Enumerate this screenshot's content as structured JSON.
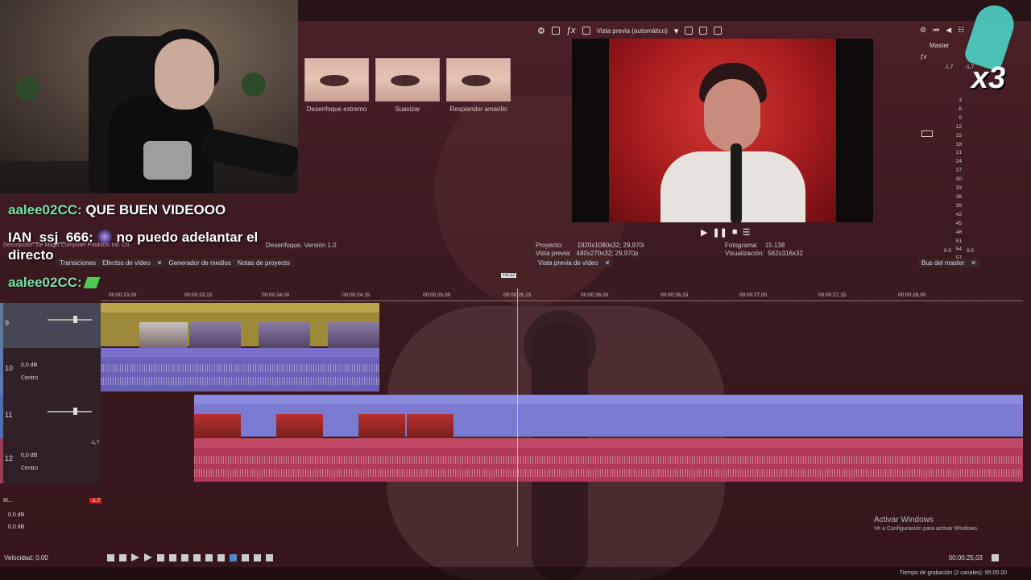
{
  "chat": {
    "messages": [
      {
        "user": "aalee02CC:",
        "text": "QUE BUEN VIDEOOO"
      },
      {
        "user": "IAN_ssj_666:",
        "text": "no puedo adelantar el",
        "text2": "directo"
      },
      {
        "user": "aalee02CC:",
        "text": ""
      }
    ]
  },
  "fx": {
    "presets": [
      "Desenfoque extremo",
      "Suavizar",
      "Resplandor amarillo"
    ],
    "desc": "Desenfoque. Versión 1.0",
    "desc_left": "Descripción: De Magix Computer Products Intl. Co."
  },
  "tabs_left": [
    "Transiciones",
    "Efectos de vídeo",
    "Generador de medios",
    "Notas de proyecto"
  ],
  "preview": {
    "toolbar_label": "Vista previa (automático)",
    "project_label": "Proyecto:",
    "project_value": "1920x1080x32; 29,970i",
    "preview_label": "Vista previa:",
    "preview_value": "480x270x32; 29,970p",
    "frame_label": "Fotograma:",
    "frame_value": "15.138",
    "display_label": "Visualización:",
    "display_value": "562x316x32",
    "tab": "Vista previa de vídeo"
  },
  "master": {
    "label": "Master",
    "peak_l": "-1,7",
    "peak_r": "-1,7",
    "scale": [
      "3",
      "6",
      "9",
      "12",
      "15",
      "18",
      "21",
      "24",
      "27",
      "30",
      "33",
      "36",
      "39",
      "42",
      "45",
      "48",
      "51",
      "54",
      "57"
    ],
    "bottom_l": "0.0",
    "bottom_r": "0.0",
    "tab": "Bus del master"
  },
  "overlay": {
    "multiplier": "x3"
  },
  "timeline": {
    "marker": "+5:12",
    "ruler": [
      "00:00:23,00",
      "00:00:23,15",
      "00:00:24,00",
      "00:00:24,15",
      "00:00:25,00",
      "00:00:25,15",
      "00:00:26,00",
      "00:00:26,15",
      "00:00:27,00",
      "00:00:27,15",
      "00:00:28,00"
    ],
    "tracks": [
      {
        "num": "9",
        "vol": "",
        "pan": ""
      },
      {
        "num": "10",
        "vol": "0,0 dB",
        "pan": "Centro"
      },
      {
        "num": "11",
        "vol": "",
        "pan": ""
      },
      {
        "num": "12",
        "vol": "0,0 dB",
        "pan": "Centro"
      }
    ],
    "master_vol1": "0,0 dB",
    "master_vol2": "0,0 dB",
    "track12_peak": "-1,7",
    "m_label": "M...",
    "m_peak": "-1,7"
  },
  "transport": {
    "speed": "Velocidad: 0,00",
    "time": "00:00:25,03"
  },
  "status": {
    "record_time": "Tiempo de grabación (2 canales): 95:05:20"
  },
  "windows": {
    "activate_title": "Activar Windows",
    "activate_sub": "Ve a Configuración para activar Windows."
  }
}
